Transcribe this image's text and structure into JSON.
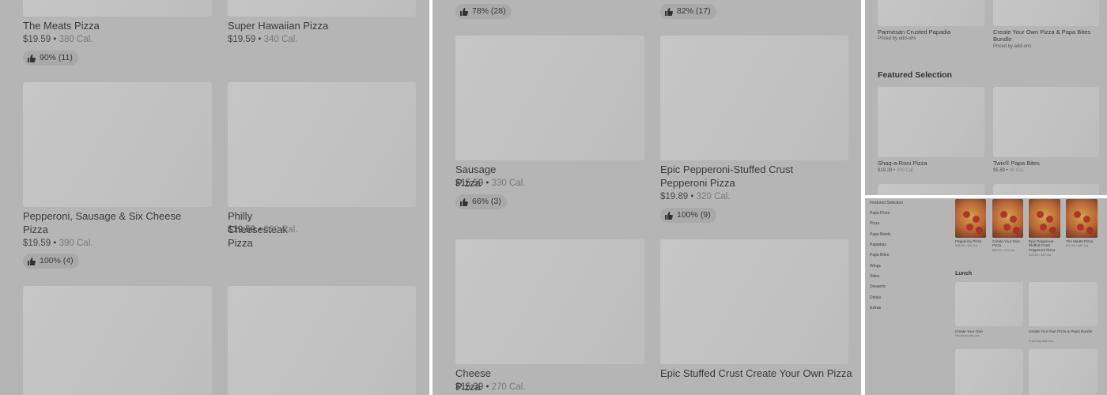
{
  "panel1": {
    "items": [
      {
        "name": "The Meats Pizza",
        "price": "$19.59",
        "cal": "380 Cal.",
        "rating": "90% (11)"
      },
      {
        "name": "Super Hawaiian Pizza",
        "price": "$19.59",
        "cal": "340 Cal."
      },
      {
        "name": "Pepperoni, Sausage & Six Cheese Pizza",
        "price": "$19.59",
        "cal": "390 Cal.",
        "rating": "100% (4)"
      },
      {
        "name": "Philly Cheesesteak Pizza",
        "price": "$19.59",
        "cal": "360 Cal."
      }
    ]
  },
  "panel2": {
    "top_ratings": [
      "78% (28)",
      "82% (17)"
    ],
    "items": [
      {
        "name": "Sausage Pizza",
        "price": "$15.59",
        "cal": "330 Cal.",
        "rating": "66% (3)"
      },
      {
        "name": "Epic Pepperoni-Stuffed Crust Pepperoni Pizza",
        "price": "$19.89",
        "cal": "320 Cal.",
        "rating": "100% (9)"
      },
      {
        "name": "Cheese Pizza",
        "price": "$15.39",
        "cal": "270 Cal."
      },
      {
        "name": "Epic Stuffed Crust Create Your Own Pizza"
      }
    ]
  },
  "panel3": {
    "top_items": [
      {
        "name": "Parmesan Crusted Papadia",
        "note": "Priced by add-ons"
      },
      {
        "name": "Create Your Own Pizza & Papa Bites Bundle",
        "note": "Priced by add-ons"
      }
    ],
    "section_title": "Featured Selection",
    "items": [
      {
        "name": "Shaq-a-Roni Pizza",
        "price": "$19.29",
        "cal": "390 Cal."
      },
      {
        "name": "Twix® Papa Bites",
        "price": "$5.69",
        "cal": "80 Cal."
      }
    ]
  },
  "panel4": {
    "nav": [
      "Featured Selection",
      "Papa Picks",
      "Pizza",
      "Papa Bowls",
      "Papadias",
      "Papa Bites",
      "Wings",
      "Sides",
      "Desserts",
      "Drinks",
      "Extras"
    ],
    "top_items": [
      {
        "name": "Pepperoni Pizza",
        "price": "$15.59",
        "cal": "320 Cal."
      },
      {
        "name": "Create Your Own Pizza",
        "price": "$15.39",
        "cal": "270 Cal."
      },
      {
        "name": "Epic Pepperoni-Stuffed Crust Pepperoni Pizza",
        "price": "$19.89",
        "cal": "320 Cal."
      },
      {
        "name": "The Meats Pizza",
        "price": "$19.59",
        "cal": "380 Cal."
      }
    ],
    "section_title": "Lunch",
    "lunch_items": [
      {
        "name": "Create Your Own",
        "note": "Priced by add-ons"
      },
      {
        "name": "Create Your Own Pizza & Pepsi Bundle",
        "note": "Priced by add-ons"
      }
    ]
  },
  "icons": {
    "rating": "thumbs-up-icon"
  },
  "colors": {
    "overlay": "#b5b5b5",
    "thumbnail": "#c3c3c3",
    "rating_pill": "#a9a9a9"
  }
}
